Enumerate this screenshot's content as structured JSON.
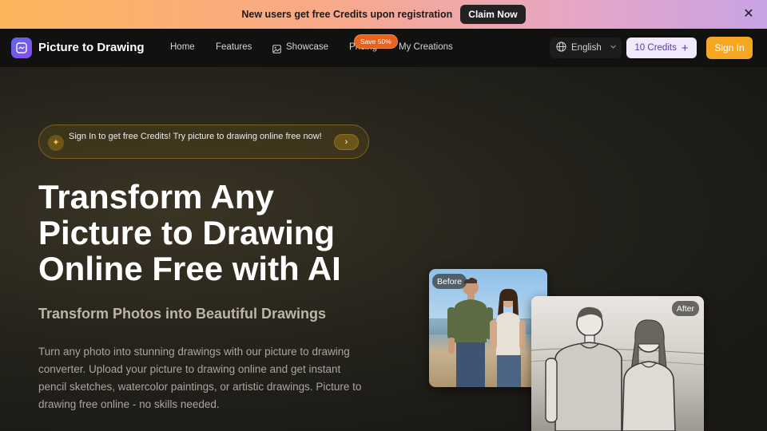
{
  "promo": {
    "text": "New users get free Credits upon registration",
    "button": "Claim Now",
    "close": "✕"
  },
  "nav": {
    "brand": "Picture to Drawing",
    "links": {
      "home": "Home",
      "features": "Features",
      "showcase": "Showcase",
      "pricing": "Pricing",
      "creations": "My Creations"
    },
    "save_badge": "Save 50%",
    "language": "English",
    "credits": "10 Credits",
    "credits_plus": "+",
    "sign_in": "Sign In"
  },
  "hero": {
    "pill_text": "Sign In to get free Credits! Try picture to drawing online free now!",
    "pill_arrow": "›",
    "headline": "Transform Any Picture to Drawing Online Free with AI",
    "subhead": "Transform Photos into Beautiful Drawings",
    "description": "Turn any photo into stunning drawings with our picture to drawing converter. Upload your picture to drawing online and get instant pencil sketches, watercolor paintings, or artistic drawings. Picture to drawing free online - no skills needed.",
    "before_label": "Before",
    "after_label": "After"
  },
  "colors": {
    "accent": "#f5a623",
    "credits_bg": "#f0e9fb",
    "save_badge": "#e8621d"
  }
}
